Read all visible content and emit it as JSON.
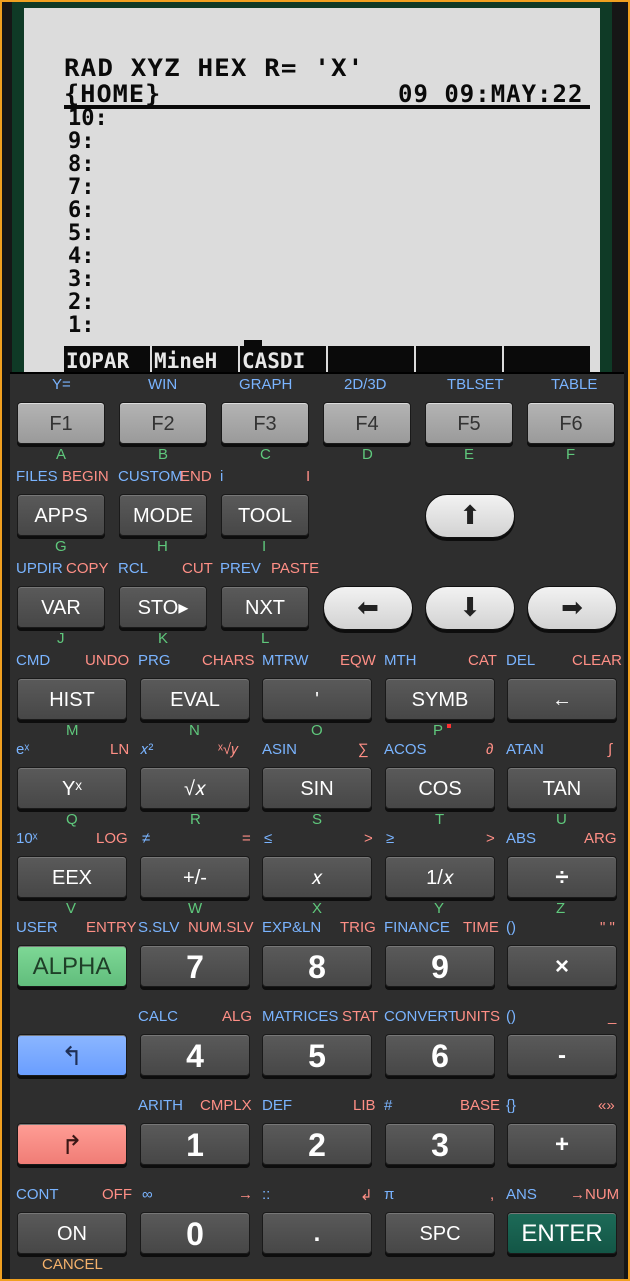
{
  "screen": {
    "status_line1": "RAD XYZ HEX R= 'X'",
    "status_line2_left": "{HOME}",
    "status_line2_right": "09 09:MAY:22",
    "stack_levels": [
      "10:",
      "9:",
      "8:",
      "7:",
      "6:",
      "5:",
      "4:",
      "3:",
      "2:",
      "1:"
    ],
    "softmenu": [
      "IOPAR",
      "MineH",
      "CASDI",
      "",
      "",
      ""
    ]
  },
  "fkeys": {
    "top_labels": [
      "Y=",
      "WIN",
      "GRAPH",
      "2D/3D",
      "TBLSET",
      "TABLE"
    ],
    "labels": [
      "F1",
      "F2",
      "F3",
      "F4",
      "F5",
      "F6"
    ],
    "letters": [
      "A",
      "B",
      "C",
      "D",
      "E",
      "F"
    ]
  },
  "row2": {
    "files": "FILES",
    "begin": "BEGIN",
    "custom": "CUSTOM",
    "end": "END",
    "i_blue": "i",
    "i_red": "I",
    "apps": "APPS",
    "mode": "MODE",
    "tool": "TOOL",
    "g": "G",
    "h": "H",
    "i": "I"
  },
  "row3": {
    "updir": "UPDIR",
    "copy": "COPY",
    "rcl": "RCL",
    "cut": "CUT",
    "prev": "PREV",
    "paste": "PASTE",
    "var": "VAR",
    "sto": "STO▸",
    "nxt": "NXT",
    "j": "J",
    "k": "K",
    "l": "L"
  },
  "arrows": {
    "up": "⬆",
    "left": "⬅",
    "down": "⬇",
    "right": "➡"
  },
  "row4": {
    "top": [
      [
        "CMD",
        "UNDO"
      ],
      [
        "PRG",
        "CHARS"
      ],
      [
        "MTRW",
        "EQW"
      ],
      [
        "MTH",
        "CAT"
      ],
      [
        "DEL",
        "CLEAR"
      ]
    ],
    "keys": [
      "HIST",
      "EVAL",
      "'",
      "SYMB",
      "←"
    ],
    "letters": [
      "M",
      "N",
      "O",
      "P",
      ""
    ]
  },
  "row5": {
    "top": [
      [
        "eˣ",
        "LN"
      ],
      [
        "𝑥²",
        "ˣ√𝑦"
      ],
      [
        "ASIN",
        "∑"
      ],
      [
        "ACOS",
        "∂"
      ],
      [
        "ATAN",
        "∫"
      ]
    ],
    "keys": [
      "Yˣ",
      "√𝑥",
      "SIN",
      "COS",
      "TAN"
    ],
    "letters": [
      "Q",
      "R",
      "S",
      "T",
      "U"
    ]
  },
  "row6": {
    "top": [
      [
        "10ˣ",
        "LOG"
      ],
      [
        "≠",
        "="
      ],
      [
        "≤",
        ">"
      ],
      [
        "≥",
        ">"
      ],
      [
        "ABS",
        "ARG"
      ]
    ],
    "keys": [
      "EEX",
      "+/-",
      "𝑥",
      "1/𝑥",
      "÷"
    ],
    "letters": [
      "V",
      "W",
      "X",
      "Y",
      "Z"
    ]
  },
  "row7": {
    "top": [
      [
        "USER",
        "ENTRY"
      ],
      [
        "S.SLV",
        "NUM.SLV"
      ],
      [
        "EXP&LN",
        "TRIG"
      ],
      [
        "FINANCE",
        "TIME"
      ],
      [
        "()",
        "\" \""
      ]
    ],
    "keys": [
      "ALPHA",
      "7",
      "8",
      "9",
      "×"
    ]
  },
  "row8": {
    "top": [
      [
        "",
        ""
      ],
      [
        "CALC",
        "ALG"
      ],
      [
        "MATRICES",
        "STAT"
      ],
      [
        "CONVERT",
        "UNITS"
      ],
      [
        "()",
        "_"
      ]
    ],
    "keys": [
      "↰",
      "4",
      "5",
      "6",
      "-"
    ]
  },
  "row9": {
    "top": [
      [
        "",
        ""
      ],
      [
        "ARITH",
        "CMPLX"
      ],
      [
        "DEF",
        "LIB"
      ],
      [
        "#",
        "BASE"
      ],
      [
        "{}",
        "«»"
      ]
    ],
    "keys": [
      "↱",
      "1",
      "2",
      "3",
      "+"
    ]
  },
  "row10": {
    "top": [
      [
        "CONT",
        "OFF"
      ],
      [
        "∞",
        "→"
      ],
      [
        "::",
        "↲"
      ],
      [
        "π",
        ","
      ],
      [
        "ANS",
        "→NUM"
      ]
    ],
    "keys": [
      "ON",
      "0",
      ".",
      "SPC",
      "ENTER"
    ],
    "cancel": "CANCEL"
  }
}
